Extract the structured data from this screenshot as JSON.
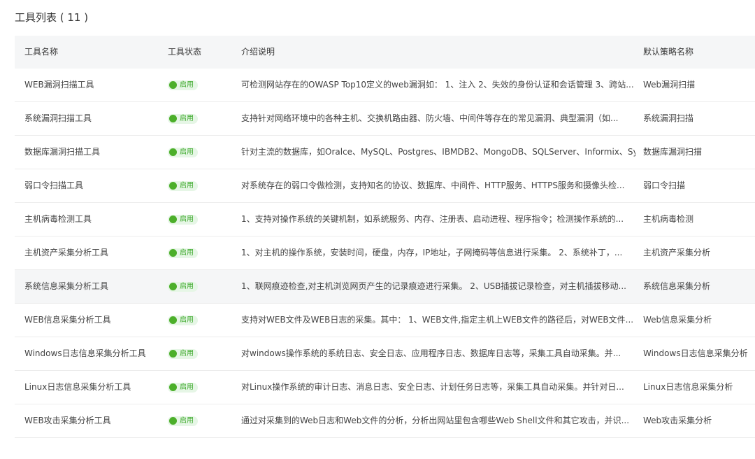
{
  "title": "工具列表 ( 11 )",
  "columns": {
    "name": "工具名称",
    "status": "工具状态",
    "desc": "介绍说明",
    "policy": "默认策略名称"
  },
  "status_color": "#4caf2a",
  "rows": [
    {
      "name": "WEB漏洞扫描工具",
      "status": "启用",
      "desc": "可检测网站存在的OWASP Top10定义的web漏洞如： 1、注入 2、失效的身份认证和会话管理 3、跨站...",
      "policy": "Web漏洞扫描"
    },
    {
      "name": "系统漏洞扫描工具",
      "status": "启用",
      "desc": "支持针对网络环境中的各种主机、交换机路由器、防火墙、中间件等存在的常见漏洞、典型漏洞（如...",
      "policy": "系统漏洞扫描"
    },
    {
      "name": "数据库漏洞扫描工具",
      "status": "启用",
      "desc": "针对主流的数据库，如Oralce、MySQL、Postgres、IBMDB2、MongoDB、SQLServer、Informix、Syb...",
      "policy": "数据库漏洞扫描"
    },
    {
      "name": "弱口令扫描工具",
      "status": "启用",
      "desc": "对系统存在的弱口令做检测，支持知名的协议、数据库、中间件、HTTP服务、HTTPS服务和摄像头检...",
      "policy": "弱口令扫描"
    },
    {
      "name": "主机病毒检测工具",
      "status": "启用",
      "desc": "1、支持对操作系统的关键机制，如系统服务、内存、注册表、启动进程、程序指令；检测操作系统的...",
      "policy": "主机病毒检测"
    },
    {
      "name": "主机资产采集分析工具",
      "status": "启用",
      "desc": "1、对主机的操作系统，安装时间，硬盘，内存，IP地址，子网掩码等信息进行采集。 2、系统补丁，...",
      "policy": "主机资产采集分析"
    },
    {
      "name": "系统信息采集分析工具",
      "status": "启用",
      "desc": "1、联网痕迹检查,对主机浏览网页产生的记录痕迹进行采集。 2、USB插拔记录检查，对主机插拔移动...",
      "policy": "系统信息采集分析"
    },
    {
      "name": "WEB信息采集分析工具",
      "status": "启用",
      "desc": "支持对WEB文件及WEB日志的采集。其中： 1、WEB文件,指定主机上WEB文件的路径后，对WEB文件...",
      "policy": "Web信息采集分析"
    },
    {
      "name": "Windows日志信息采集分析工具",
      "status": "启用",
      "desc": "对windows操作系统的系统日志、安全日志、应用程序日志、数据库日志等，采集工具自动采集。并...",
      "policy": "Windows日志信息采集分析"
    },
    {
      "name": "Linux日志信息采集分析工具",
      "status": "启用",
      "desc": "对Linux操作系统的审计日志、消息日志、安全日志、计划任务日志等，采集工具自动采集。并针对日...",
      "policy": "Linux日志信息采集分析"
    },
    {
      "name": "WEB攻击采集分析工具",
      "status": "启用",
      "desc": "通过对采集到的Web日志和Web文件的分析，分析出网站里包含哪些Web Shell文件和其它攻击，并识...",
      "policy": "Web攻击采集分析"
    }
  ]
}
